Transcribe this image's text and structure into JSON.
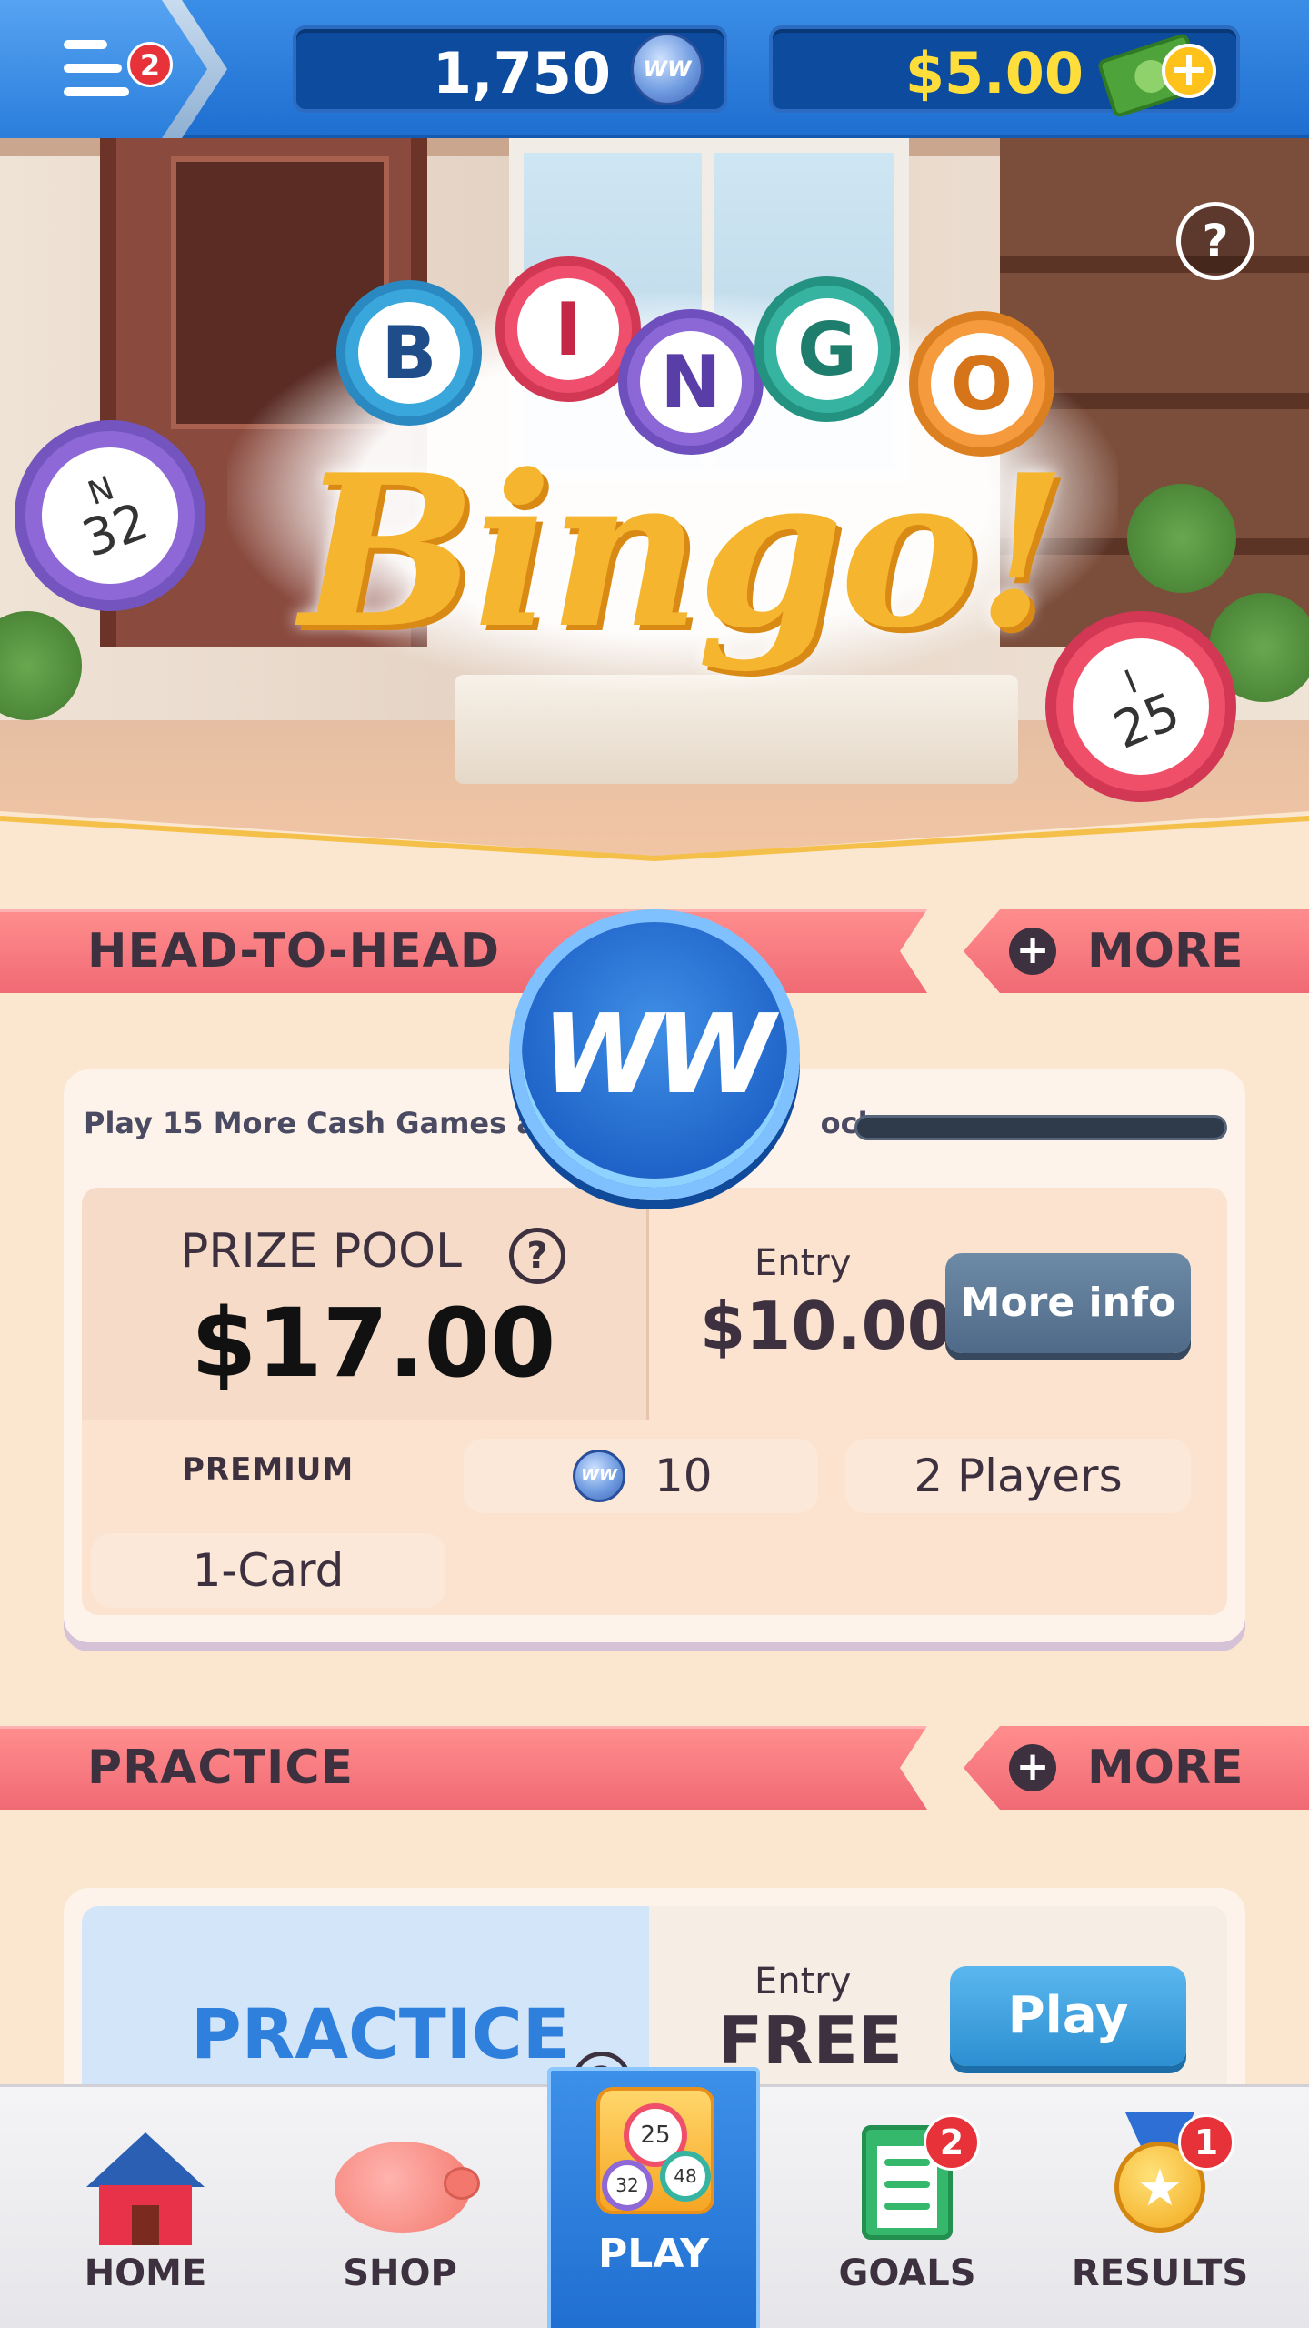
{
  "topbar": {
    "menu_badge": "2",
    "coins": "1,750",
    "coin_icon_label": "WW",
    "cash": "$5.00",
    "cash_plus": "+"
  },
  "hero": {
    "logo_letters": [
      "B",
      "I",
      "N",
      "G",
      "O"
    ],
    "logo_script": "Bingo!",
    "ball_left": {
      "letter": "N",
      "number": "32"
    },
    "ball_right": {
      "letter": "I",
      "number": "25"
    },
    "help": "?"
  },
  "sections": {
    "head_to_head": {
      "title": "HEAD-TO-HEAD",
      "more_label": "MORE"
    },
    "practice": {
      "title": "PRACTICE",
      "more_label": "MORE"
    }
  },
  "ww_badge": "WW",
  "h2h_card": {
    "progress_text": "Play 15 More Cash Games an",
    "progress_text_tail": "ock",
    "prize_label": "PRIZE POOL",
    "prize_help": "?",
    "prize_value": "$17.00",
    "entry_label": "Entry",
    "entry_value": "$10.00",
    "more_info_label": "More info",
    "tier": "PREMIUM",
    "coins_reward": "10",
    "players": "2 Players",
    "cards": "1-Card"
  },
  "practice_card": {
    "title": "PRACTICE",
    "help": "?",
    "entry_label": "Entry",
    "entry_value": "FREE",
    "play_label": "Play"
  },
  "bottom_nav": {
    "home": "HOME",
    "shop": "SHOP",
    "play": "PLAY",
    "goals": "GOALS",
    "goals_badge": "2",
    "results": "RESULTS",
    "results_badge": "1",
    "play_balls": [
      "25",
      "32",
      "48"
    ]
  },
  "colors": {
    "topbar_blue": "#1f6fd1",
    "ribbon_pink": "#f06a74",
    "cash_yellow": "#ffde3b",
    "badge_red": "#e8323a",
    "practice_blue": "#2f7fdc"
  }
}
